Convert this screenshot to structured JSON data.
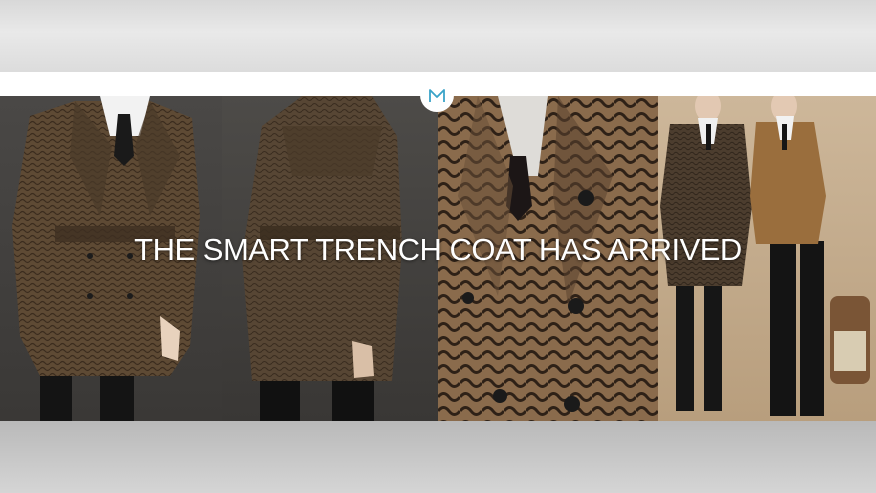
{
  "banner": {
    "headline": "THE SMART TRENCH COAT HAS ARRIVED",
    "logo_icon": "m-logo-icon",
    "accent_color": "#3aa3c8"
  },
  "photos": [
    {
      "name": "trench-front-photo"
    },
    {
      "name": "trench-back-photo"
    },
    {
      "name": "trench-closeup-photo"
    },
    {
      "name": "two-models-photo"
    }
  ]
}
